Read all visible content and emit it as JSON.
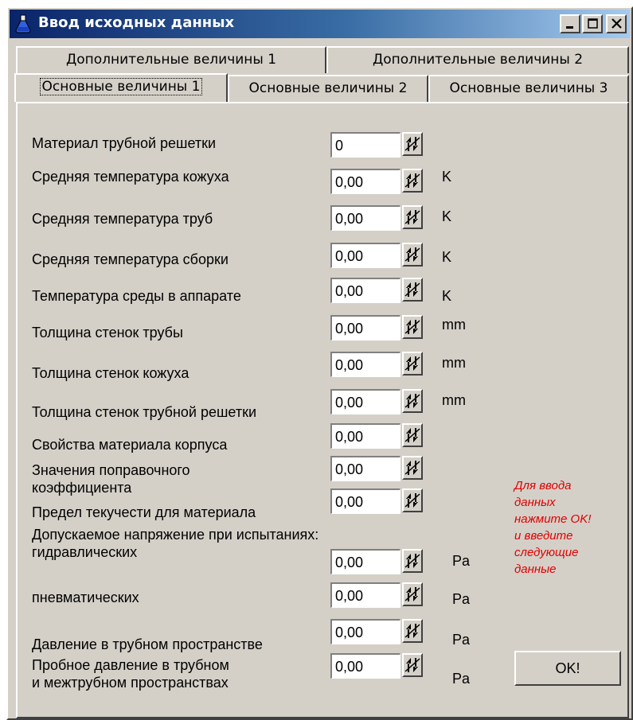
{
  "window": {
    "title": "Ввод исходных данных",
    "controls": {
      "minimize": "_",
      "maximize": "□",
      "close": "×"
    }
  },
  "tabs": {
    "row_top": [
      "Дополнительные величины 1",
      "Дополнительные величины 2"
    ],
    "row_bottom": [
      "Основные величины 1",
      "Основные величины 2",
      "Основные величины 3"
    ],
    "active": "Основные величины 1"
  },
  "fields": [
    {
      "label": "Материал трубной решетки",
      "value": "0",
      "unit": ""
    },
    {
      "label": "Средняя температура кожуха",
      "value": "0,00",
      "unit": "K"
    },
    {
      "label": "Средняя температура труб",
      "value": "0,00",
      "unit": "K"
    },
    {
      "label": "Средняя температура сборки",
      "value": "0,00",
      "unit": "K"
    },
    {
      "label": "Температура среды в аппарате",
      "value": "0,00",
      "unit": "K"
    },
    {
      "label": "Толщина стенок трубы",
      "value": "0,00",
      "unit": "mm"
    },
    {
      "label": "Толщина стенок кожуха",
      "value": "0,00",
      "unit": "mm"
    },
    {
      "label": "Толщина стенок трубной решетки",
      "value": "0,00",
      "unit": "mm"
    },
    {
      "label": "Свойства материала корпуса",
      "value": "0,00",
      "unit": ""
    },
    {
      "label": "Значения поправочного",
      "label2": "коэффициента",
      "value": "0,00",
      "unit": ""
    },
    {
      "label": "Предел текучести для материала",
      "value": "0,00",
      "unit": ""
    },
    {
      "label": "гидравлических",
      "value": "0,00",
      "unit": "Pa"
    },
    {
      "label": "пневматических",
      "value": "0,00",
      "unit": "Pa"
    },
    {
      "label": "Давление в трубном пространстве",
      "value": "0,00",
      "unit": "Pa"
    },
    {
      "label": "Пробное давление в трубном",
      "label2": "и межтрубном пространствах",
      "value": "0,00",
      "unit": "Pa"
    }
  ],
  "section_heading": "Допускаемое напряжение при испытаниях:",
  "hint": [
    "Для ввода",
    "данных",
    "нажмите OK!",
    "и введите",
    "следующие",
    "данные"
  ],
  "ok_button": "OK!",
  "colors": {
    "title_start": "#0a246a",
    "title_end": "#a6caf0",
    "face": "#d4d0c8",
    "hint": "#e00000"
  }
}
